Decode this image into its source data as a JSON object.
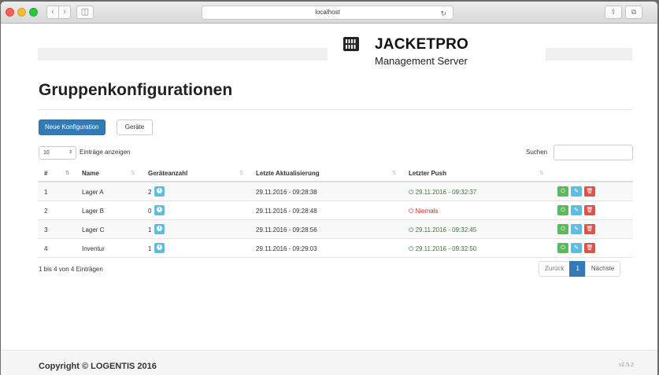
{
  "browser": {
    "url": "localhost",
    "back_icon": "‹",
    "forward_icon": "›",
    "reload_icon": "↻",
    "share_icon": "⇧",
    "tabs_icon": "⧉"
  },
  "brand": {
    "title": "JACKETPRO",
    "subtitle": "Management Server"
  },
  "page": {
    "title": "Gruppenkonfigurationen"
  },
  "toolbar": {
    "new_config_label": "Neue Konfiguration",
    "devices_label": "Geräte"
  },
  "table_controls": {
    "page_length": "10",
    "page_length_caret": "⇕",
    "entries_label": "Einträge anzeigen",
    "search_label": "Suchen"
  },
  "table": {
    "columns": [
      "#",
      "Name",
      "Geräteanzahl",
      "Letzte Aktualisierung",
      "Letzter Push"
    ],
    "sort_icon": "⇅",
    "rows": [
      {
        "num": "1",
        "name": "Lager A",
        "count": "2",
        "updated": "29.11.2016 - 09:28:38",
        "push": "29.11.2016 - 09:32:37",
        "push_status": "ok"
      },
      {
        "num": "2",
        "name": "Lager B",
        "count": "0",
        "updated": "29.11.2016 - 09:28:48",
        "push": "Niemals",
        "push_status": "never"
      },
      {
        "num": "3",
        "name": "Lager C",
        "count": "1",
        "updated": "29.11.2016 - 09:28:56",
        "push": "29.11.2016 - 09:32:45",
        "push_status": "ok"
      },
      {
        "num": "4",
        "name": "Inventur",
        "count": "1",
        "updated": "29.11.2016 - 09:29:03",
        "push": "29.11.2016 - 09:32:50",
        "push_status": "ok"
      }
    ],
    "push_ok_icon": "⏻",
    "push_never_icon": "⏻",
    "action_icons": {
      "push": "⏻",
      "edit": "✎",
      "delete": "🗑"
    }
  },
  "pagination": {
    "info": "1 bis 4 von 4 Einträgen",
    "prev": "Zurück",
    "current": "1",
    "next": "Nächste"
  },
  "footer": {
    "copyright": "Copyright © LOGENTIS 2016",
    "version": "v2.5.2"
  },
  "colors": {
    "primary": "#337ab7",
    "success": "#5cb85c",
    "info": "#5bc0de",
    "danger": "#d9534f",
    "ok_text": "#3c763d",
    "never_text": "#c9302c"
  }
}
